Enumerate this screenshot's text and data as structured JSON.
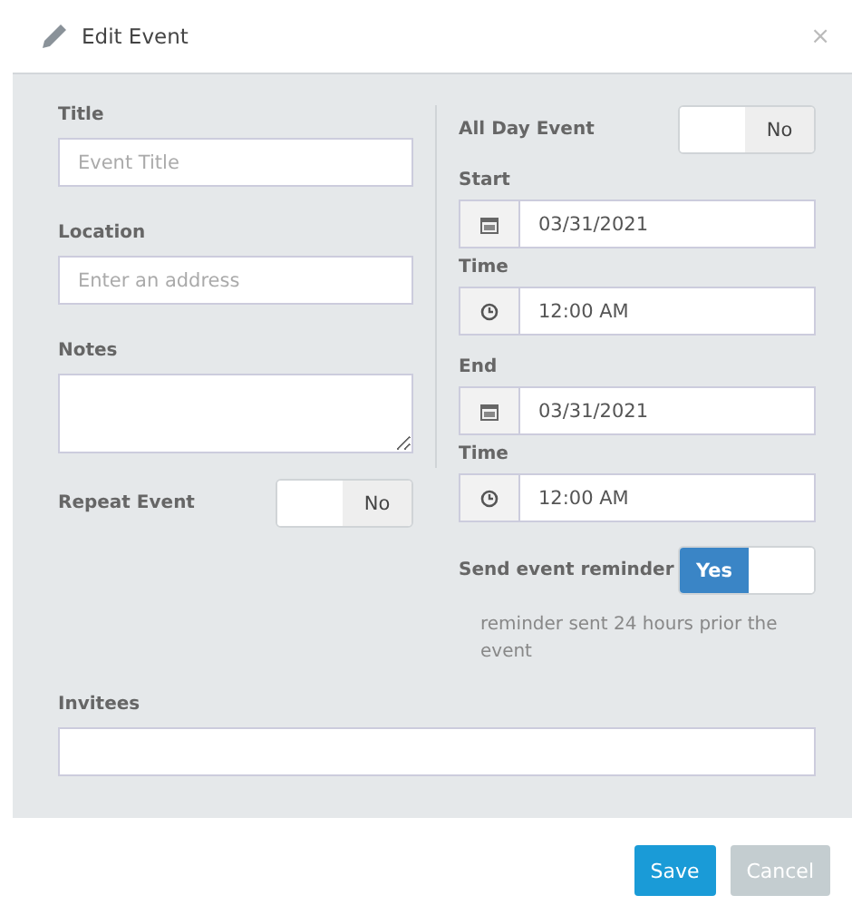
{
  "dialog": {
    "title": "Edit Event",
    "close": "×"
  },
  "title_field": {
    "label": "Title",
    "placeholder": "Event Title"
  },
  "location_field": {
    "label": "Location",
    "placeholder": "Enter an address"
  },
  "notes_field": {
    "label": "Notes"
  },
  "repeat_event": {
    "label": "Repeat Event",
    "on": false,
    "state_label": "No"
  },
  "all_day_event": {
    "label": "All Day Event",
    "on": false,
    "state_label": "No"
  },
  "start": {
    "label": "Start",
    "date": "03/31/2021",
    "time_label": "Time",
    "time": "12:00 AM"
  },
  "end": {
    "label": "End",
    "date": "03/31/2021",
    "time_label": "Time",
    "time": "12:00 AM"
  },
  "send_reminder": {
    "label": "Send event reminder",
    "on": true,
    "state_label": "Yes",
    "note": "reminder sent 24 hours prior the event"
  },
  "invitees": {
    "label": "Invitees"
  },
  "buttons": [
    {
      "label": "Save",
      "kind": "primary"
    },
    {
      "label": "Cancel",
      "kind": "secondary"
    }
  ]
}
